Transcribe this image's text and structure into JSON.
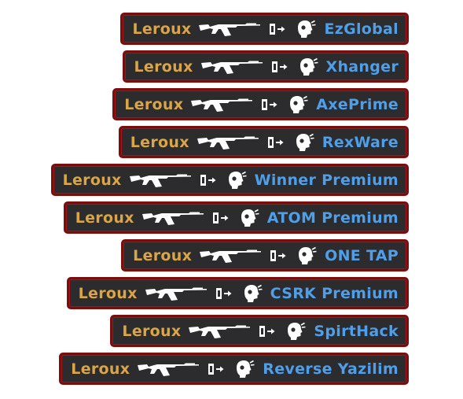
{
  "colors": {
    "background": "#2c2c2e",
    "border": "#7a0d0d",
    "attacker_name": "#d8a548",
    "victim_name": "#4f9ee8",
    "icon": "#ffffff"
  },
  "kill_feed": [
    {
      "attacker": "Leroux",
      "weapon_icon": "ak47-icon",
      "wallbang_icon": "penetrate-icon",
      "headshot_icon": "headshot-icon",
      "victim": "EzGlobal"
    },
    {
      "attacker": "Leroux",
      "weapon_icon": "ak47-icon",
      "wallbang_icon": "penetrate-icon",
      "headshot_icon": "headshot-icon",
      "victim": "Xhanger"
    },
    {
      "attacker": "Leroux",
      "weapon_icon": "ak47-icon",
      "wallbang_icon": "penetrate-icon",
      "headshot_icon": "headshot-icon",
      "victim": "AxePrime"
    },
    {
      "attacker": "Leroux",
      "weapon_icon": "ak47-icon",
      "wallbang_icon": "penetrate-icon",
      "headshot_icon": "headshot-icon",
      "victim": "RexWare"
    },
    {
      "attacker": "Leroux",
      "weapon_icon": "ak47-icon",
      "wallbang_icon": "penetrate-icon",
      "headshot_icon": "headshot-icon",
      "victim": "Winner Premium"
    },
    {
      "attacker": "Leroux",
      "weapon_icon": "ak47-icon",
      "wallbang_icon": "penetrate-icon",
      "headshot_icon": "headshot-icon",
      "victim": "ATOM Premium"
    },
    {
      "attacker": "Leroux",
      "weapon_icon": "ak47-icon",
      "wallbang_icon": "penetrate-icon",
      "headshot_icon": "headshot-icon",
      "victim": "ONE TAP"
    },
    {
      "attacker": "Leroux",
      "weapon_icon": "ak47-icon",
      "wallbang_icon": "penetrate-icon",
      "headshot_icon": "headshot-icon",
      "victim": "CSRK Premium"
    },
    {
      "attacker": "Leroux",
      "weapon_icon": "ak47-icon",
      "wallbang_icon": "penetrate-icon",
      "headshot_icon": "headshot-icon",
      "victim": "SpirtHack"
    },
    {
      "attacker": "Leroux",
      "weapon_icon": "ak47-icon",
      "wallbang_icon": "penetrate-icon",
      "headshot_icon": "headshot-icon",
      "victim": "Reverse Yazilim"
    }
  ]
}
